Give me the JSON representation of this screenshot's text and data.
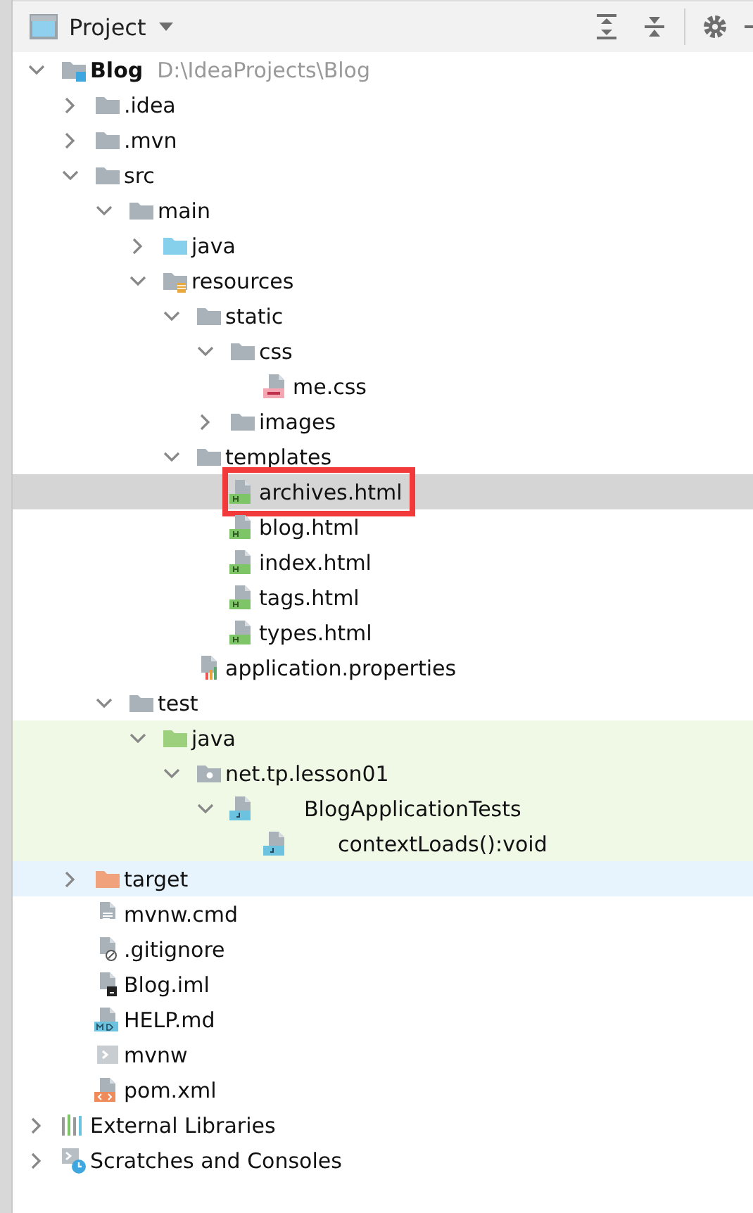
{
  "header": {
    "title": "Project"
  },
  "tree": [
    {
      "label": "Blog",
      "path": "D:\\IdeaProjects\\Blog",
      "kind": "module",
      "expanded": true,
      "selected": false,
      "children": [
        {
          "label": ".idea",
          "kind": "folder",
          "expanded": false,
          "selected": false
        },
        {
          "label": ".mvn",
          "kind": "folder",
          "expanded": false,
          "selected": false
        },
        {
          "label": "src",
          "kind": "folder",
          "expanded": true,
          "selected": false,
          "children": [
            {
              "label": "main",
              "kind": "folder",
              "expanded": true,
              "selected": false,
              "children": [
                {
                  "label": "java",
                  "kind": "source",
                  "expanded": false,
                  "selected": false
                },
                {
                  "label": "resources",
                  "kind": "resources",
                  "expanded": true,
                  "selected": false,
                  "children": [
                    {
                      "label": "static",
                      "kind": "folder",
                      "expanded": true,
                      "selected": false,
                      "children": [
                        {
                          "label": "css",
                          "kind": "folder",
                          "expanded": true,
                          "selected": false,
                          "children": [
                            {
                              "label": "me.css",
                              "kind": "css",
                              "selected": false
                            }
                          ]
                        },
                        {
                          "label": "images",
                          "kind": "folder",
                          "expanded": false,
                          "selected": false
                        }
                      ]
                    },
                    {
                      "label": "templates",
                      "kind": "folder",
                      "expanded": true,
                      "selected": false,
                      "children": [
                        {
                          "label": "archives.html",
                          "kind": "html",
                          "selected": true,
                          "annotated": true
                        },
                        {
                          "label": "blog.html",
                          "kind": "html",
                          "selected": false
                        },
                        {
                          "label": "index.html",
                          "kind": "html",
                          "selected": false
                        },
                        {
                          "label": "tags.html",
                          "kind": "html",
                          "selected": false
                        },
                        {
                          "label": "types.html",
                          "kind": "html",
                          "selected": false
                        }
                      ]
                    },
                    {
                      "label": "application.properties",
                      "kind": "properties",
                      "selected": false
                    }
                  ]
                }
              ]
            },
            {
              "label": "test",
              "kind": "folder",
              "expanded": true,
              "selected": false,
              "children": [
                {
                  "label": "java",
                  "kind": "test",
                  "test_scope": true,
                  "expanded": true,
                  "selected": false,
                  "children": [
                    {
                      "label": "net.tp.lesson01",
                      "kind": "package",
                      "test_scope": true,
                      "expanded": true,
                      "selected": false,
                      "children": [
                        {
                          "label": "BlogApplicationTests",
                          "kind": "class",
                          "test_scope": true,
                          "expanded": true,
                          "selected": false,
                          "children": [
                            {
                              "label": "contextLoads():void",
                              "kind": "method",
                              "test_scope": true,
                              "selected": false
                            }
                          ]
                        }
                      ]
                    }
                  ]
                }
              ]
            }
          ]
        },
        {
          "label": "target",
          "kind": "excluded",
          "excluded": true,
          "expanded": false,
          "selected": false
        },
        {
          "label": "mvnw.cmd",
          "kind": "text",
          "selected": false
        },
        {
          "label": ".gitignore",
          "kind": "ignore",
          "selected": false
        },
        {
          "label": "Blog.iml",
          "kind": "iml",
          "selected": false
        },
        {
          "label": "HELP.md",
          "kind": "md",
          "selected": false
        },
        {
          "label": "mvnw",
          "kind": "script",
          "selected": false
        },
        {
          "label": "pom.xml",
          "kind": "xml",
          "selected": false
        }
      ]
    },
    {
      "label": "External Libraries",
      "kind": "libraries",
      "expanded": false,
      "selected": false
    },
    {
      "label": "Scratches and Consoles",
      "kind": "scratches",
      "expanded": false,
      "selected": false
    }
  ]
}
